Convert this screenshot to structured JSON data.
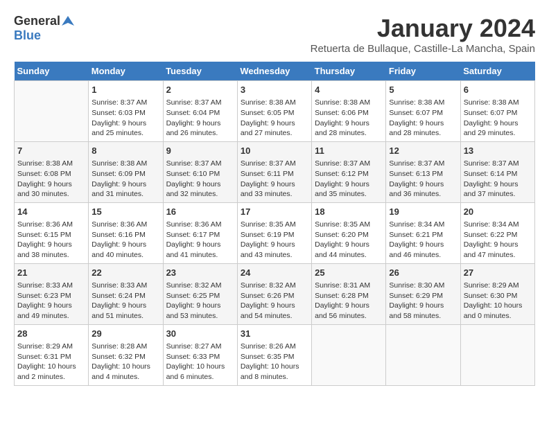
{
  "header": {
    "logo_general": "General",
    "logo_blue": "Blue",
    "title": "January 2024",
    "subtitle": "Retuerta de Bullaque, Castille-La Mancha, Spain"
  },
  "weekdays": [
    "Sunday",
    "Monday",
    "Tuesday",
    "Wednesday",
    "Thursday",
    "Friday",
    "Saturday"
  ],
  "weeks": [
    [
      {
        "day": "",
        "sunrise": "",
        "sunset": "",
        "daylight": ""
      },
      {
        "day": "1",
        "sunrise": "Sunrise: 8:37 AM",
        "sunset": "Sunset: 6:03 PM",
        "daylight": "Daylight: 9 hours and 25 minutes."
      },
      {
        "day": "2",
        "sunrise": "Sunrise: 8:37 AM",
        "sunset": "Sunset: 6:04 PM",
        "daylight": "Daylight: 9 hours and 26 minutes."
      },
      {
        "day": "3",
        "sunrise": "Sunrise: 8:38 AM",
        "sunset": "Sunset: 6:05 PM",
        "daylight": "Daylight: 9 hours and 27 minutes."
      },
      {
        "day": "4",
        "sunrise": "Sunrise: 8:38 AM",
        "sunset": "Sunset: 6:06 PM",
        "daylight": "Daylight: 9 hours and 28 minutes."
      },
      {
        "day": "5",
        "sunrise": "Sunrise: 8:38 AM",
        "sunset": "Sunset: 6:07 PM",
        "daylight": "Daylight: 9 hours and 28 minutes."
      },
      {
        "day": "6",
        "sunrise": "Sunrise: 8:38 AM",
        "sunset": "Sunset: 6:07 PM",
        "daylight": "Daylight: 9 hours and 29 minutes."
      }
    ],
    [
      {
        "day": "7",
        "sunrise": "Sunrise: 8:38 AM",
        "sunset": "Sunset: 6:08 PM",
        "daylight": "Daylight: 9 hours and 30 minutes."
      },
      {
        "day": "8",
        "sunrise": "Sunrise: 8:38 AM",
        "sunset": "Sunset: 6:09 PM",
        "daylight": "Daylight: 9 hours and 31 minutes."
      },
      {
        "day": "9",
        "sunrise": "Sunrise: 8:37 AM",
        "sunset": "Sunset: 6:10 PM",
        "daylight": "Daylight: 9 hours and 32 minutes."
      },
      {
        "day": "10",
        "sunrise": "Sunrise: 8:37 AM",
        "sunset": "Sunset: 6:11 PM",
        "daylight": "Daylight: 9 hours and 33 minutes."
      },
      {
        "day": "11",
        "sunrise": "Sunrise: 8:37 AM",
        "sunset": "Sunset: 6:12 PM",
        "daylight": "Daylight: 9 hours and 35 minutes."
      },
      {
        "day": "12",
        "sunrise": "Sunrise: 8:37 AM",
        "sunset": "Sunset: 6:13 PM",
        "daylight": "Daylight: 9 hours and 36 minutes."
      },
      {
        "day": "13",
        "sunrise": "Sunrise: 8:37 AM",
        "sunset": "Sunset: 6:14 PM",
        "daylight": "Daylight: 9 hours and 37 minutes."
      }
    ],
    [
      {
        "day": "14",
        "sunrise": "Sunrise: 8:36 AM",
        "sunset": "Sunset: 6:15 PM",
        "daylight": "Daylight: 9 hours and 38 minutes."
      },
      {
        "day": "15",
        "sunrise": "Sunrise: 8:36 AM",
        "sunset": "Sunset: 6:16 PM",
        "daylight": "Daylight: 9 hours and 40 minutes."
      },
      {
        "day": "16",
        "sunrise": "Sunrise: 8:36 AM",
        "sunset": "Sunset: 6:17 PM",
        "daylight": "Daylight: 9 hours and 41 minutes."
      },
      {
        "day": "17",
        "sunrise": "Sunrise: 8:35 AM",
        "sunset": "Sunset: 6:19 PM",
        "daylight": "Daylight: 9 hours and 43 minutes."
      },
      {
        "day": "18",
        "sunrise": "Sunrise: 8:35 AM",
        "sunset": "Sunset: 6:20 PM",
        "daylight": "Daylight: 9 hours and 44 minutes."
      },
      {
        "day": "19",
        "sunrise": "Sunrise: 8:34 AM",
        "sunset": "Sunset: 6:21 PM",
        "daylight": "Daylight: 9 hours and 46 minutes."
      },
      {
        "day": "20",
        "sunrise": "Sunrise: 8:34 AM",
        "sunset": "Sunset: 6:22 PM",
        "daylight": "Daylight: 9 hours and 47 minutes."
      }
    ],
    [
      {
        "day": "21",
        "sunrise": "Sunrise: 8:33 AM",
        "sunset": "Sunset: 6:23 PM",
        "daylight": "Daylight: 9 hours and 49 minutes."
      },
      {
        "day": "22",
        "sunrise": "Sunrise: 8:33 AM",
        "sunset": "Sunset: 6:24 PM",
        "daylight": "Daylight: 9 hours and 51 minutes."
      },
      {
        "day": "23",
        "sunrise": "Sunrise: 8:32 AM",
        "sunset": "Sunset: 6:25 PM",
        "daylight": "Daylight: 9 hours and 53 minutes."
      },
      {
        "day": "24",
        "sunrise": "Sunrise: 8:32 AM",
        "sunset": "Sunset: 6:26 PM",
        "daylight": "Daylight: 9 hours and 54 minutes."
      },
      {
        "day": "25",
        "sunrise": "Sunrise: 8:31 AM",
        "sunset": "Sunset: 6:28 PM",
        "daylight": "Daylight: 9 hours and 56 minutes."
      },
      {
        "day": "26",
        "sunrise": "Sunrise: 8:30 AM",
        "sunset": "Sunset: 6:29 PM",
        "daylight": "Daylight: 9 hours and 58 minutes."
      },
      {
        "day": "27",
        "sunrise": "Sunrise: 8:29 AM",
        "sunset": "Sunset: 6:30 PM",
        "daylight": "Daylight: 10 hours and 0 minutes."
      }
    ],
    [
      {
        "day": "28",
        "sunrise": "Sunrise: 8:29 AM",
        "sunset": "Sunset: 6:31 PM",
        "daylight": "Daylight: 10 hours and 2 minutes."
      },
      {
        "day": "29",
        "sunrise": "Sunrise: 8:28 AM",
        "sunset": "Sunset: 6:32 PM",
        "daylight": "Daylight: 10 hours and 4 minutes."
      },
      {
        "day": "30",
        "sunrise": "Sunrise: 8:27 AM",
        "sunset": "Sunset: 6:33 PM",
        "daylight": "Daylight: 10 hours and 6 minutes."
      },
      {
        "day": "31",
        "sunrise": "Sunrise: 8:26 AM",
        "sunset": "Sunset: 6:35 PM",
        "daylight": "Daylight: 10 hours and 8 minutes."
      },
      {
        "day": "",
        "sunrise": "",
        "sunset": "",
        "daylight": ""
      },
      {
        "day": "",
        "sunrise": "",
        "sunset": "",
        "daylight": ""
      },
      {
        "day": "",
        "sunrise": "",
        "sunset": "",
        "daylight": ""
      }
    ]
  ]
}
